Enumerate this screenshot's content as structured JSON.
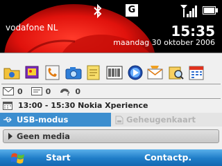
{
  "status_bar": {
    "operator": "vodafone NL",
    "network_letter": "G",
    "time": "15:35",
    "date": "maandag 30 oktober 2006"
  },
  "today": {
    "app_icons": [
      "folder-icon",
      "pictures-icon",
      "phone-icon",
      "camera-icon",
      "notes-icon",
      "barcode-icon",
      "media-player-icon",
      "messaging-icon",
      "contacts-search-icon",
      "calendar-icon"
    ],
    "messages": [
      {
        "icon": "email-icon",
        "count": "0"
      },
      {
        "icon": "sms-icon",
        "count": "0"
      },
      {
        "icon": "voicemail-icon",
        "count": "0"
      }
    ],
    "appointment": "13:00 - 15:30 Nokia Xperience",
    "usb_mode": "USB-modus",
    "storage_card": "Geheugenkaart",
    "media": "Geen media"
  },
  "softkeys": {
    "left": "Start",
    "right": "Contactp."
  },
  "colors": {
    "accent": "#3c8ecf",
    "softbar": "#1e7cc7",
    "panel": "#f0f0f0"
  }
}
